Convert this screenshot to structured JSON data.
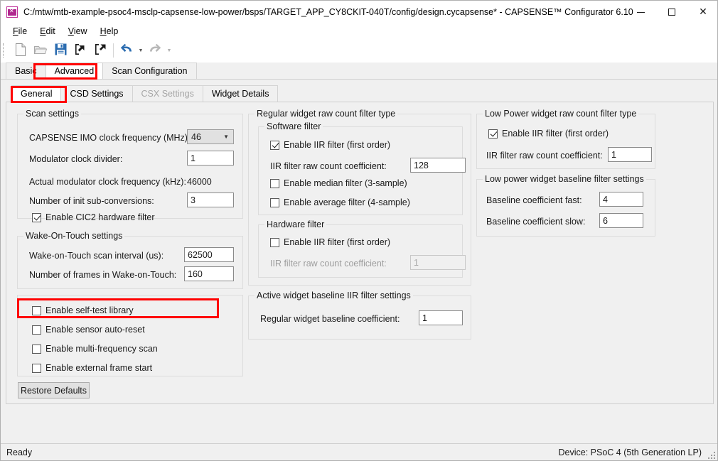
{
  "window": {
    "title": "C:/mtw/mtb-example-psoc4-msclp-capsense-low-power/bsps/TARGET_APP_CY8CKIT-040T/config/design.cycapsense* - CAPSENSE™ Configurator 6.10",
    "app_icon": "capsense-app-icon",
    "minimize_label": "–",
    "maximize_label": "□",
    "close_label": "✕"
  },
  "menubar": {
    "items": [
      {
        "acc": "F",
        "rest": "ile"
      },
      {
        "acc": "E",
        "rest": "dit"
      },
      {
        "acc": "V",
        "rest": "iew"
      },
      {
        "acc": "H",
        "rest": "elp"
      }
    ]
  },
  "toolbar": {
    "buttons": [
      {
        "name": "new-file-icon",
        "enabled": true
      },
      {
        "name": "open-file-icon",
        "enabled": false
      },
      {
        "name": "save-file-icon",
        "enabled": true
      },
      {
        "name": "import-icon",
        "enabled": true
      },
      {
        "name": "export-icon",
        "enabled": true
      },
      {
        "name": "undo-icon",
        "enabled": true
      },
      {
        "name": "redo-icon",
        "enabled": false
      }
    ]
  },
  "tabs_outer": {
    "items": [
      {
        "label": "Basic",
        "active": false,
        "disabled": false
      },
      {
        "label": "Advanced",
        "active": true,
        "disabled": false
      },
      {
        "label": "Scan Configuration",
        "active": false,
        "disabled": false
      }
    ]
  },
  "tabs_inner": {
    "items": [
      {
        "label": "General",
        "active": true,
        "disabled": false
      },
      {
        "label": "CSD Settings",
        "active": false,
        "disabled": false
      },
      {
        "label": "CSX Settings",
        "active": false,
        "disabled": true
      },
      {
        "label": "Widget Details",
        "active": false,
        "disabled": false
      }
    ]
  },
  "scan_settings": {
    "legend": "Scan settings",
    "imo_label": "CAPSENSE IMO clock frequency (MHz):",
    "imo_value": "46",
    "modulator_divider_label": "Modulator clock divider:",
    "modulator_divider_value": "1",
    "actual_mod_label": "Actual modulator clock frequency (kHz):",
    "actual_mod_value": "46000",
    "init_subconv_label": "Number of init sub-conversions:",
    "init_subconv_value": "3",
    "cic2_label": "Enable CIC2 hardware filter",
    "cic2_checked": true
  },
  "wake_on_touch": {
    "legend": "Wake-On-Touch settings",
    "interval_label": "Wake-on-Touch scan interval (us):",
    "interval_value": "62500",
    "frames_label": "Number of frames in Wake-on-Touch:",
    "frames_value": "160"
  },
  "misc_options": {
    "items": [
      {
        "label": "Enable self-test library",
        "checked": false,
        "highlighted": true
      },
      {
        "label": "Enable sensor auto-reset",
        "checked": false,
        "highlighted": false
      },
      {
        "label": "Enable multi-frequency scan",
        "checked": false,
        "highlighted": false
      },
      {
        "label": "Enable external frame start",
        "checked": false,
        "highlighted": false
      }
    ]
  },
  "restore_defaults": {
    "label": "Restore Defaults"
  },
  "regular_filter": {
    "legend": "Regular widget raw count filter type",
    "software": {
      "legend": "Software filter",
      "iir_label": "Enable IIR filter (first order)",
      "iir_checked": true,
      "coeff_label": "IIR filter raw count coefficient:",
      "coeff_value": "128",
      "median_label": "Enable median filter (3-sample)",
      "median_checked": false,
      "average_label": "Enable average filter (4-sample)",
      "average_checked": false
    },
    "hardware": {
      "legend": "Hardware filter",
      "iir_label": "Enable IIR filter (first order)",
      "iir_checked": false,
      "coeff_label": "IIR filter raw count coefficient:",
      "coeff_value": "1",
      "coeff_disabled": true
    }
  },
  "active_baseline": {
    "legend": "Active widget baseline IIR filter settings",
    "coeff_label": "Regular widget baseline coefficient:",
    "coeff_value": "1"
  },
  "low_power_filter": {
    "legend": "Low Power widget raw count filter type",
    "iir_label": "Enable IIR filter (first order)",
    "iir_checked": true,
    "coeff_label": "IIR filter raw count coefficient:",
    "coeff_value": "1"
  },
  "low_power_baseline": {
    "legend": "Low power widget baseline filter settings",
    "fast_label": "Baseline coefficient fast:",
    "fast_value": "4",
    "slow_label": "Baseline coefficient slow:",
    "slow_value": "6"
  },
  "statusbar": {
    "left": "Ready",
    "right": "Device: PSoC 4 (5th Generation LP)"
  },
  "colors": {
    "highlight": "#ff0000",
    "accent": "#2b6cb0",
    "window_bg": "#f0f0f0",
    "app_icon": "#b0278e"
  }
}
